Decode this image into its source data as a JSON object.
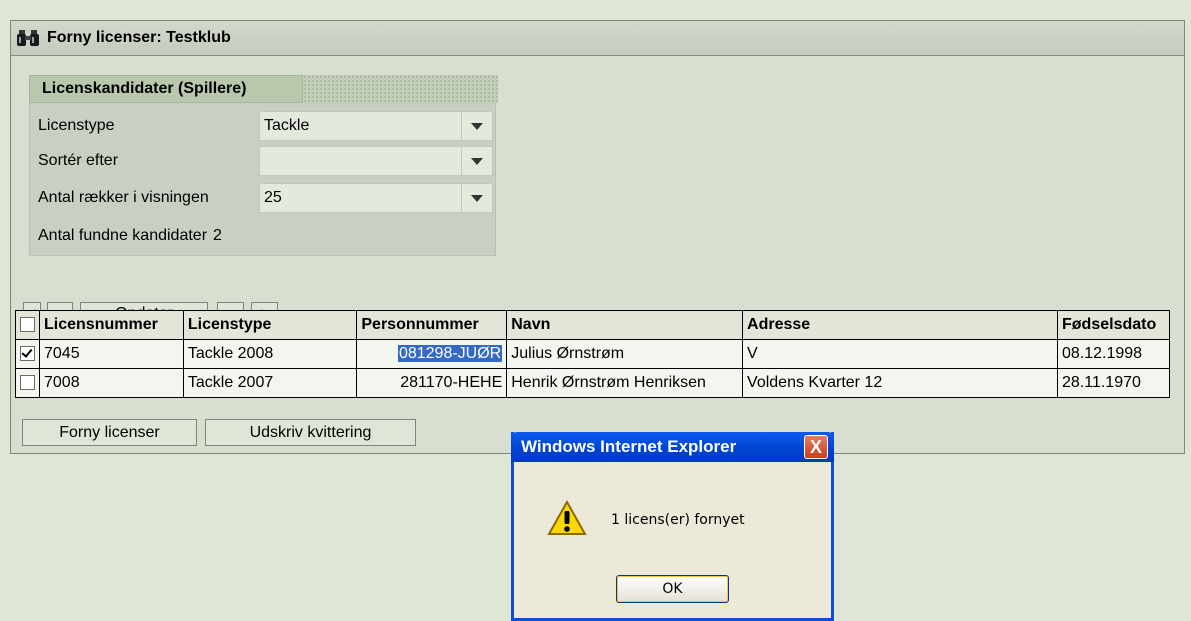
{
  "window": {
    "title": "Forny licenser: Testklub"
  },
  "filter": {
    "tab_label": "Licenskandidater (Spillere)",
    "rows": [
      {
        "label": "Licenstype",
        "value": "Tackle"
      },
      {
        "label": "Sortér efter",
        "value": ""
      },
      {
        "label": "Antal rækker i visningen",
        "value": "25"
      }
    ],
    "found_label": "Antal fundne kandidater",
    "found_value": "2"
  },
  "nav": {
    "first": "<",
    "prev": "«",
    "refresh": "Opdater",
    "next": "»",
    "last": ">"
  },
  "table": {
    "headers": [
      "Licensnummer",
      "Licenstype",
      "Personnummer",
      "Navn",
      "Adresse",
      "Fødselsdato"
    ],
    "rows": [
      {
        "checked": true,
        "cells": [
          "7045",
          "Tackle 2008",
          "081298-JUØR",
          "Julius Ørnstrøm",
          "V",
          "08.12.1998"
        ]
      },
      {
        "checked": false,
        "cells": [
          "7008",
          "Tackle 2007",
          "281170-HEHE",
          "Henrik Ørnstrøm Henriksen",
          "Voldens Kvarter 12",
          "28.11.1970"
        ]
      }
    ]
  },
  "actions": {
    "renew": "Forny licenser",
    "print": "Udskriv kvittering"
  },
  "dialog": {
    "title": "Windows Internet Explorer",
    "close": "X",
    "message": "1 licens(er) fornyet",
    "ok": "OK"
  },
  "colors": {
    "selection": "#3469c4",
    "dialog_title": "#0043d0"
  }
}
